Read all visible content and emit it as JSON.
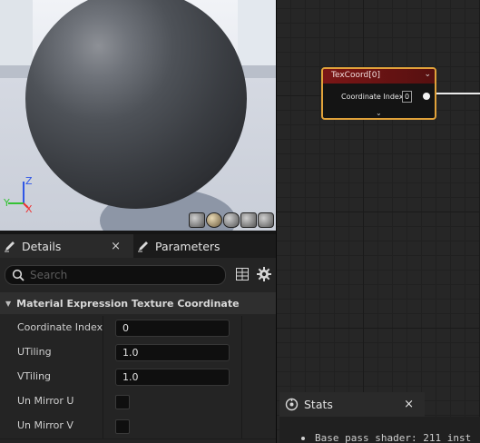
{
  "viewport": {
    "axis_labels": {
      "y": "Y",
      "z": "Z",
      "x": "X"
    },
    "preview_shapes": [
      "cylinder-icon",
      "sphere-icon",
      "plane-icon",
      "cube-icon",
      "teapot-icon"
    ]
  },
  "tabs": {
    "details": {
      "label": "Details",
      "close": "×"
    },
    "parameters": {
      "label": "Parameters"
    }
  },
  "details": {
    "search_placeholder": "Search",
    "category": "Material Expression Texture Coordinate",
    "properties": [
      {
        "label": "Coordinate Index",
        "value": "0"
      },
      {
        "label": "UTiling",
        "value": "1.0"
      },
      {
        "label": "VTiling",
        "value": "1.0"
      },
      {
        "label": "Un Mirror U",
        "checked": false
      },
      {
        "label": "Un Mirror V",
        "checked": false
      }
    ]
  },
  "node": {
    "title": "TexCoord[0]",
    "pin_label": "Coordinate Index",
    "pin_value": "0",
    "header_color": "#7b1616",
    "border_color": "#e1a23a"
  },
  "stats": {
    "tab_label": "Stats",
    "close": "×",
    "line": "Base pass shader: 211 inst"
  }
}
